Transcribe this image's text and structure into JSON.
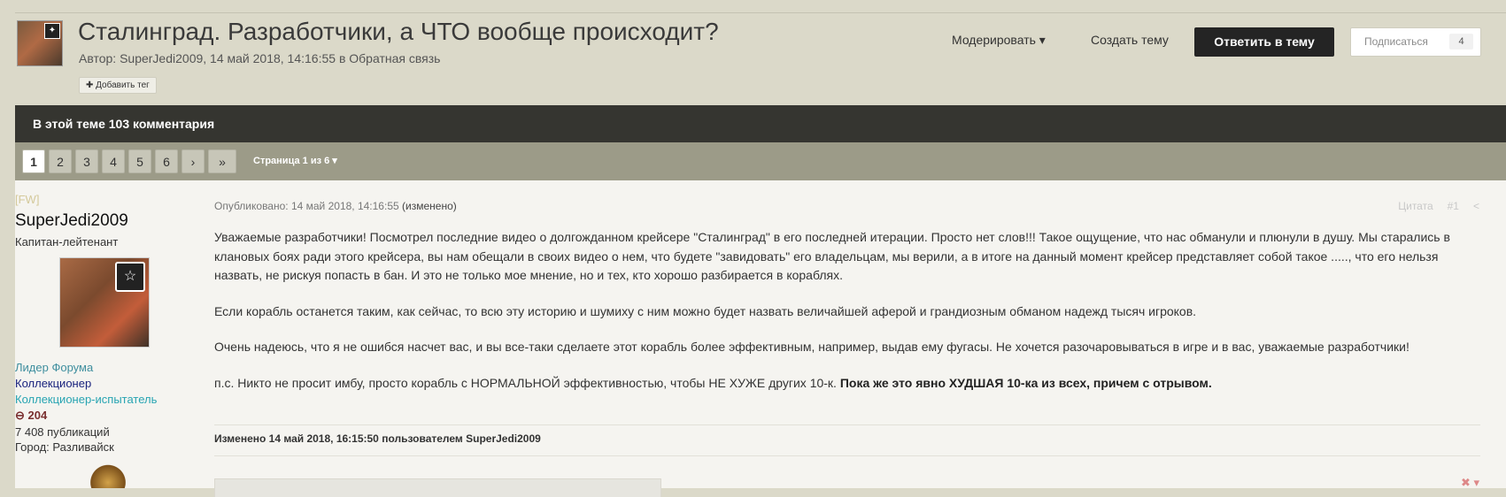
{
  "topic": {
    "title": "Сталинград. Разработчики, а ЧТО вообще происходит?",
    "meta_prefix": "Автор: ",
    "author": "SuperJedi2009",
    "meta_date": ", 14 май 2018, 14:16:55 в ",
    "forum": "Обратная связь",
    "add_tag": "✚ Добавить тег"
  },
  "actions": {
    "moderate": "Модерировать ▾",
    "create_topic": "Создать тему",
    "reply": "Ответить в тему",
    "subscribe": "Подписаться",
    "subscribe_count": "4"
  },
  "comments_bar": "В этой теме 103 комментария",
  "pagination": {
    "pages": [
      "1",
      "2",
      "3",
      "4",
      "5",
      "6"
    ],
    "next": "›",
    "last": "»",
    "page_of": "Страница 1 из 6 ▾"
  },
  "post": {
    "author_tag": "[FW]",
    "author_name": "SuperJedi2009",
    "author_rank": "Капитан-лейтенант",
    "rank_icon": "chevron-stars",
    "groups": [
      "Лидер Форума",
      "Коллекционер",
      "Коллекционер-испытатель"
    ],
    "reputation": "⊖ 204",
    "posts_count": "7 408 публикаций",
    "city": "Город: Разливайск",
    "published": "Опубликовано: 14 май 2018, 14:16:55",
    "edited_label": "(изменено)",
    "quote": "Цитата",
    "post_number": "#1",
    "share_icon": "share",
    "paragraphs": [
      "Уважаемые разработчики! Посмотрел последние видео о долгожданном крейсере \"Сталинград\" в его последней итерации. Просто нет слов!!! Такое ощущение, что нас обманули и плюнули в душу. Мы старались в клановых боях ради этого крейсера, вы нам обещали в своих видео о нем, что будете \"завидовать\"   его владельцам, мы верили, а в итоге на данный момент крейсер представляет собой такое ....., что его нельзя назвать, не рискуя попасть в бан. И это не только мое мнение, но и тех, кто хорошо разбирается в кораблях.",
      "Если корабль останется таким, как сейчас, то всю эту историю и шумиху  с ним можно будет назвать величайшей аферой и грандиозным обманом надежд тысяч игроков.",
      "Очень надеюсь, что я не ошибся насчет вас, и вы все-таки сделаете этот корабль более эффективным, например, выдав ему фугасы. Не хочется разочаровываться в игре и в вас, уважаемые разработчики!"
    ],
    "last_paragraph_plain": "п.с. Никто не просит имбу, просто корабль с НОРМАЛЬНОЙ эффективностью, чтобы НЕ ХУЖЕ других 10-к. ",
    "last_paragraph_bold": "Пока же это явно ХУДШАЯ 10-ка из всех, причем с отрывом.",
    "edit_note": "Изменено 14 май 2018, 16:15:50 пользователем SuperJedi2009",
    "signature_hide": "✖ ▾"
  }
}
